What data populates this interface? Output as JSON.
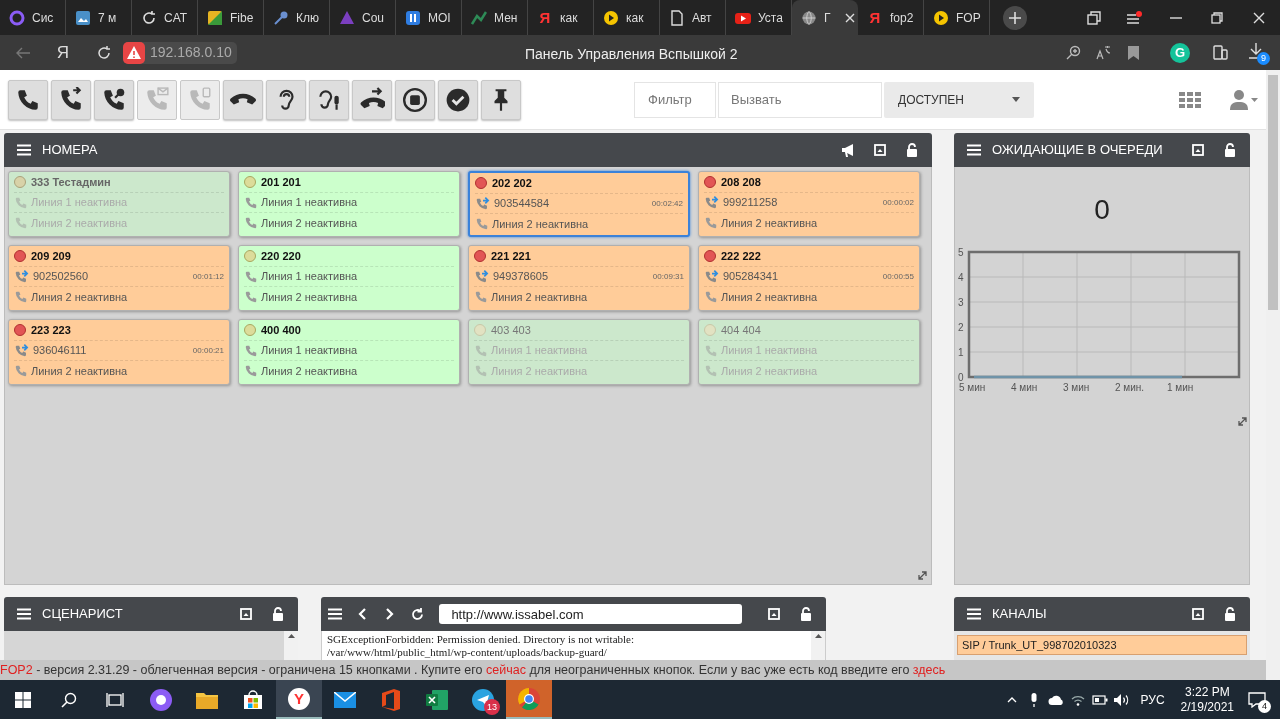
{
  "browser": {
    "tabs": [
      {
        "kind": "ring",
        "title": "Сис",
        "selected": false
      },
      {
        "kind": "photo",
        "title": "7 м",
        "selected": false
      },
      {
        "kind": "sync",
        "title": "CAT",
        "selected": false
      },
      {
        "kind": "tile",
        "title": "Fibe",
        "selected": false
      },
      {
        "kind": "key",
        "title": "Клю",
        "selected": false
      },
      {
        "kind": "triangle",
        "title": "Cou",
        "selected": false
      },
      {
        "kind": "pause",
        "title": "MOI",
        "selected": false
      },
      {
        "kind": "chart",
        "title": "Мен",
        "selected": false
      },
      {
        "kind": "letter",
        "logo": "Я",
        "title": "как",
        "selected": false
      },
      {
        "kind": "play",
        "title": "как",
        "selected": false
      },
      {
        "kind": "doc",
        "title": "Авт",
        "selected": false
      },
      {
        "kind": "video",
        "title": "Уста",
        "selected": false
      },
      {
        "kind": "globe",
        "title": "Г",
        "selected": true
      },
      {
        "kind": "letter",
        "logo": "Я",
        "title": "fop2",
        "selected": false
      },
      {
        "kind": "play",
        "title": "FOP",
        "selected": false
      }
    ],
    "address_bar": {
      "logo": "Я",
      "url": "192.168.0.10",
      "page_title": "Панель Управления Вспышкой 2",
      "grammar_logo": "G",
      "downloads_badge": "9"
    }
  },
  "toolbar": {
    "buttons": [
      {
        "kind": "phone",
        "disabled": false
      },
      {
        "kind": "phone-forward",
        "disabled": false
      },
      {
        "kind": "phone-transfer",
        "disabled": false
      },
      {
        "kind": "phone-mail",
        "disabled": true
      },
      {
        "kind": "phone-message",
        "disabled": true
      },
      {
        "kind": "hangup",
        "disabled": false
      },
      {
        "kind": "ear",
        "disabled": false
      },
      {
        "kind": "whisper",
        "disabled": false
      },
      {
        "kind": "pickup",
        "disabled": false
      },
      {
        "kind": "record",
        "disabled": false
      },
      {
        "kind": "check",
        "disabled": false
      },
      {
        "kind": "pin",
        "disabled": false
      }
    ],
    "filter": {
      "placeholder": "Фильтр"
    },
    "dial": {
      "placeholder": "Вызвать"
    },
    "presence": {
      "value": "ДОСТУПЕН"
    }
  },
  "extensions_panel": {
    "title": "НОМЕРА",
    "cards": [
      {
        "name": "333 Тестадмин",
        "kind": "unavailable",
        "selected": false,
        "lines": [
          {
            "kind": "inactive",
            "text": "Линия 1 неактивна"
          },
          {
            "kind": "inactive",
            "text": "Линия 2 неактивна"
          }
        ]
      },
      {
        "name": "201 201",
        "kind": "idle",
        "selected": false,
        "lines": [
          {
            "kind": "inactive",
            "text": "Линия 1 неактивна"
          },
          {
            "kind": "inactive",
            "text": "Линия 2 неактивна"
          }
        ]
      },
      {
        "name": "202 202",
        "kind": "busy",
        "selected": true,
        "lines": [
          {
            "kind": "active",
            "text": "903544584",
            "time": "00:02:42"
          },
          {
            "kind": "inactive",
            "text": "Линия 2 неактивна"
          }
        ]
      },
      {
        "name": "208 208",
        "kind": "busy",
        "selected": false,
        "lines": [
          {
            "kind": "active",
            "text": "999211258",
            "time": "00:00:02"
          },
          {
            "kind": "inactive",
            "text": "Линия 2 неактивна"
          }
        ]
      },
      {
        "name": "209 209",
        "kind": "busy",
        "selected": false,
        "lines": [
          {
            "kind": "active",
            "text": "902502560",
            "time": "00:01:12"
          },
          {
            "kind": "inactive",
            "text": "Линия 2 неактивна"
          }
        ]
      },
      {
        "name": "220 220",
        "kind": "idle",
        "selected": false,
        "lines": [
          {
            "kind": "inactive",
            "text": "Линия 1 неактивна"
          },
          {
            "kind": "inactive",
            "text": "Линия 2 неактивна"
          }
        ]
      },
      {
        "name": "221 221",
        "kind": "busy",
        "selected": false,
        "lines": [
          {
            "kind": "active",
            "text": "949378605",
            "time": "00:09:31"
          },
          {
            "kind": "inactive",
            "text": "Линия 2 неактивна"
          }
        ]
      },
      {
        "name": "222 222",
        "kind": "busy",
        "selected": false,
        "lines": [
          {
            "kind": "active",
            "text": "905284341",
            "time": "00:00:55"
          },
          {
            "kind": "inactive",
            "text": "Линия 2 неактивна"
          }
        ]
      },
      {
        "name": "223 223",
        "kind": "busy",
        "selected": false,
        "lines": [
          {
            "kind": "active",
            "text": "936046111",
            "time": "00:00:21"
          },
          {
            "kind": "inactive",
            "text": "Линия 2 неактивна"
          }
        ]
      },
      {
        "name": "400 400",
        "kind": "idle",
        "selected": false,
        "lines": [
          {
            "kind": "inactive",
            "text": "Линия 1 неактивна"
          },
          {
            "kind": "inactive",
            "text": "Линия 2 неактивна"
          }
        ]
      },
      {
        "name": "403 403",
        "kind": "offline",
        "selected": false,
        "lines": [
          {
            "kind": "inactive",
            "text": "Линия 1 неактивна"
          },
          {
            "kind": "inactive",
            "text": "Линия 2 неактивна"
          }
        ]
      },
      {
        "name": "404 404",
        "kind": "offline",
        "selected": false,
        "lines": [
          {
            "kind": "inactive",
            "text": "Линия 1 неактивна"
          },
          {
            "kind": "inactive",
            "text": "Линия 2 неактивна"
          }
        ]
      }
    ]
  },
  "queue_panel": {
    "title": "ОЖИДАЮЩИЕ В ОЧЕРЕДИ",
    "count": "0",
    "chart_data": {
      "type": "line",
      "grid": true,
      "categories": [
        "5 мин",
        "4 мин",
        "3 мин",
        "2 мин.",
        "1 мин"
      ],
      "ylim": [
        0,
        5
      ],
      "yticks": [
        0,
        1,
        2,
        3,
        4,
        5
      ],
      "series": [
        {
          "color": "#6f93a8",
          "values": [
            0,
            0,
            0,
            0,
            0
          ]
        }
      ]
    }
  },
  "scenario_panel": {
    "title": "СЦЕНАРИСТ"
  },
  "browser_panel": {
    "url": "http://www.issabel.com",
    "content": [
      "SGExceptionForbidden: Permission denied. Directory is not writable:",
      "/var/www/html/public_html/wp-content/uploads/backup-guard/"
    ]
  },
  "channels_panel": {
    "title": "КАНАЛЫ",
    "channels": [
      "SIP / Trunk_UT_998702010323"
    ]
  },
  "footer": [
    {
      "kind": "link",
      "text": "FOP2"
    },
    {
      "kind": "plain",
      "text": "- версия 2.31.29 - облегченная версия - ограничена 15 кнопками . Купите его"
    },
    {
      "kind": "link",
      "text": "сейчас"
    },
    {
      "kind": "plain",
      "text": "для неограниченных кнопок. Если у вас уже есть код введите его"
    },
    {
      "kind": "link",
      "text": "здесь"
    }
  ],
  "taskbar": {
    "apps": [
      {
        "kind": "start",
        "open": false,
        "selected": false
      },
      {
        "kind": "search",
        "open": false,
        "selected": false
      },
      {
        "kind": "task-view",
        "open": false,
        "selected": false
      },
      {
        "kind": "assistant",
        "open": false,
        "selected": false
      },
      {
        "kind": "folder",
        "open": false,
        "selected": false
      },
      {
        "kind": "store",
        "open": false,
        "selected": false
      },
      {
        "kind": "letter",
        "logo": "Y",
        "open": true,
        "selected": false
      },
      {
        "kind": "mail",
        "open": false,
        "selected": false
      },
      {
        "kind": "office",
        "open": false,
        "selected": false
      },
      {
        "kind": "sheet",
        "open": false,
        "selected": false
      },
      {
        "kind": "messenger",
        "badge": "13",
        "open": false,
        "selected": false
      },
      {
        "kind": "browser",
        "open": true,
        "selected": true
      }
    ],
    "tray": {
      "language": "РУС",
      "time": "3:22 PM",
      "date": "2/19/2021",
      "notifications": "4"
    }
  }
}
